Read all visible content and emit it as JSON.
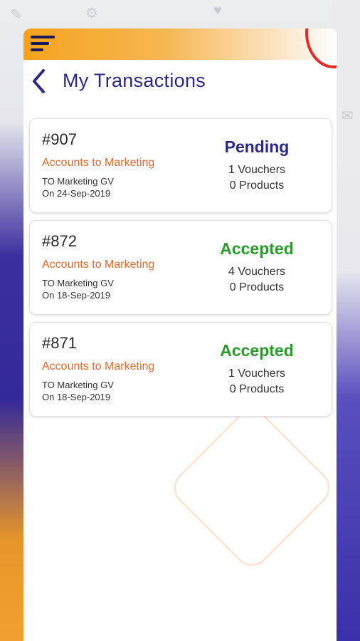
{
  "colors": {
    "accent_orange": "#f5a31c",
    "title_navy": "#2a2a86",
    "route_orange": "#e8692a",
    "status_pending": "#2a2a86",
    "status_accepted": "#2e9a2e"
  },
  "header": {
    "menu_icon": "hamburger-menu-icon",
    "back_icon": "chevron-left-icon",
    "title": "My Transactions"
  },
  "transactions": [
    {
      "id": "#907",
      "route": "Accounts to Marketing",
      "to": "TO Marketing GV",
      "date": "On 24-Sep-2019",
      "status": "Pending",
      "vouchers": "1 Vouchers",
      "products": "0 Products"
    },
    {
      "id": "#872",
      "route": "Accounts to Marketing",
      "to": "TO Marketing GV",
      "date": "On 18-Sep-2019",
      "status": "Accepted",
      "vouchers": "4 Vouchers",
      "products": "0 Products"
    },
    {
      "id": "#871",
      "route": "Accounts to Marketing",
      "to": "TO Marketing GV",
      "date": "On 18-Sep-2019",
      "status": "Accepted",
      "vouchers": "1 Vouchers",
      "products": "0 Products"
    }
  ]
}
